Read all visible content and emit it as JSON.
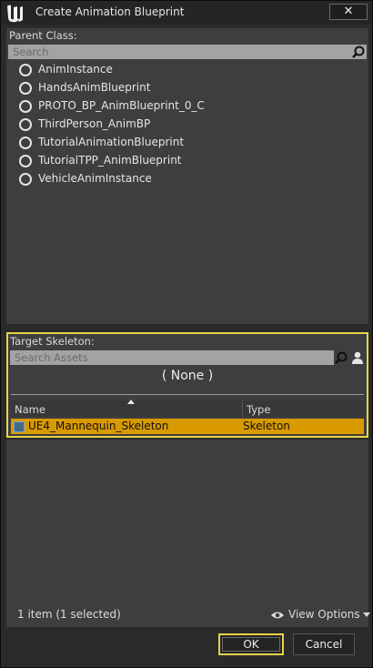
{
  "window": {
    "title": "Create Animation Blueprint",
    "close_glyph": "✕"
  },
  "parent_class": {
    "label": "Parent Class:",
    "search_placeholder": "Search",
    "items": [
      "AnimInstance",
      "HandsAnimBlueprint",
      "PROTO_BP_AnimBlueprint_0_C",
      "ThirdPerson_AnimBP",
      "TutorialAnimationBlueprint",
      "TutorialTPP_AnimBlueprint",
      "VehicleAnimInstance"
    ]
  },
  "target_skeleton": {
    "label": "Target Skeleton:",
    "search_placeholder": "Search Assets",
    "selected_display": "( None )",
    "columns": [
      "Name",
      "Type"
    ],
    "rows": [
      {
        "name": "UE4_Mannequin_Skeleton",
        "type": "Skeleton",
        "selected": true
      }
    ]
  },
  "footer": {
    "status": "1 item (1 selected)",
    "view_options": "View Options"
  },
  "buttons": {
    "ok": "OK",
    "cancel": "Cancel"
  },
  "colors": {
    "highlight": "#d99a00",
    "focus_border": "#e7d24a",
    "panel": "#3e3e3e"
  }
}
